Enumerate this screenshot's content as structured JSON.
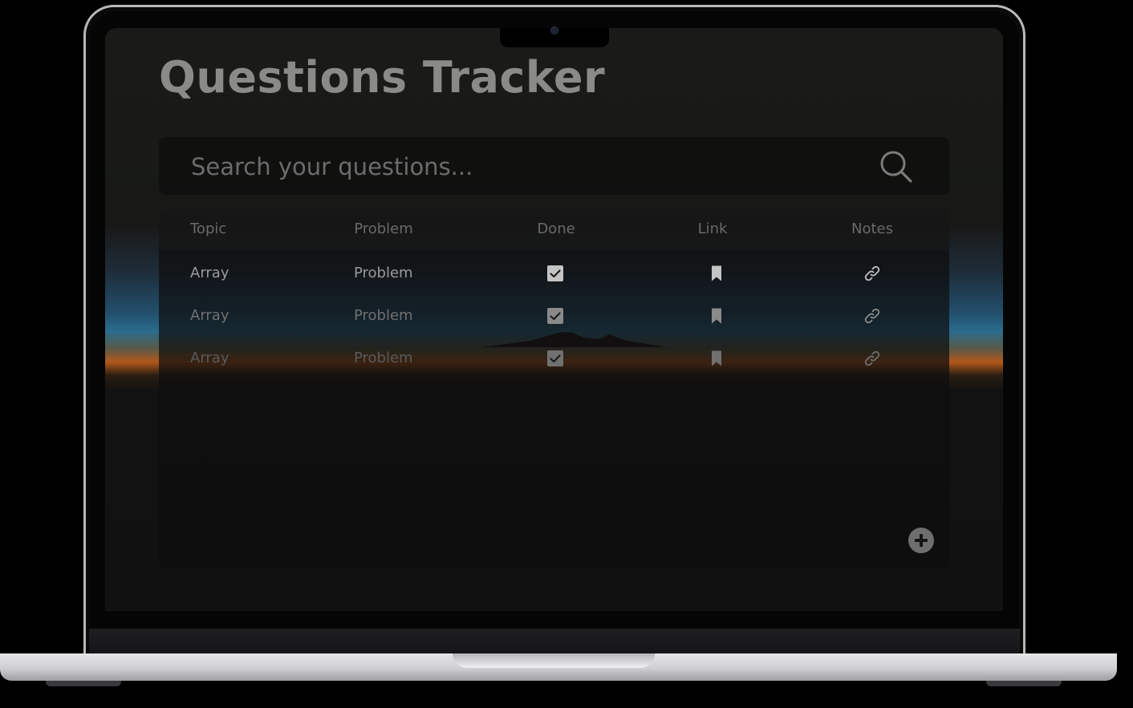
{
  "app": {
    "title": "Questions Tracker"
  },
  "search": {
    "placeholder": "Search your questions...",
    "value": "",
    "icon": "search-icon"
  },
  "table": {
    "columns": [
      "Topic",
      "Problem",
      "Done",
      "Link",
      "Notes"
    ],
    "rows": [
      {
        "topic": "Array",
        "problem": "Problem",
        "done": true,
        "link_icon": "bookmark-icon",
        "notes_icon": "link-icon"
      },
      {
        "topic": "Array",
        "problem": "Problem",
        "done": true,
        "link_icon": "bookmark-icon",
        "notes_icon": "link-icon"
      },
      {
        "topic": "Array",
        "problem": "Problem",
        "done": true,
        "link_icon": "bookmark-icon",
        "notes_icon": "link-icon"
      }
    ]
  },
  "actions": {
    "add_icon": "plus-circle-icon"
  },
  "colors": {
    "title": "#8a8a87",
    "header_text": "#6a6a6a",
    "row_text": [
      "#9a9a9a",
      "#707070",
      "#5a5a5a"
    ],
    "icon": [
      "#c4c4c4",
      "#8a8a8a",
      "#707070"
    ]
  }
}
